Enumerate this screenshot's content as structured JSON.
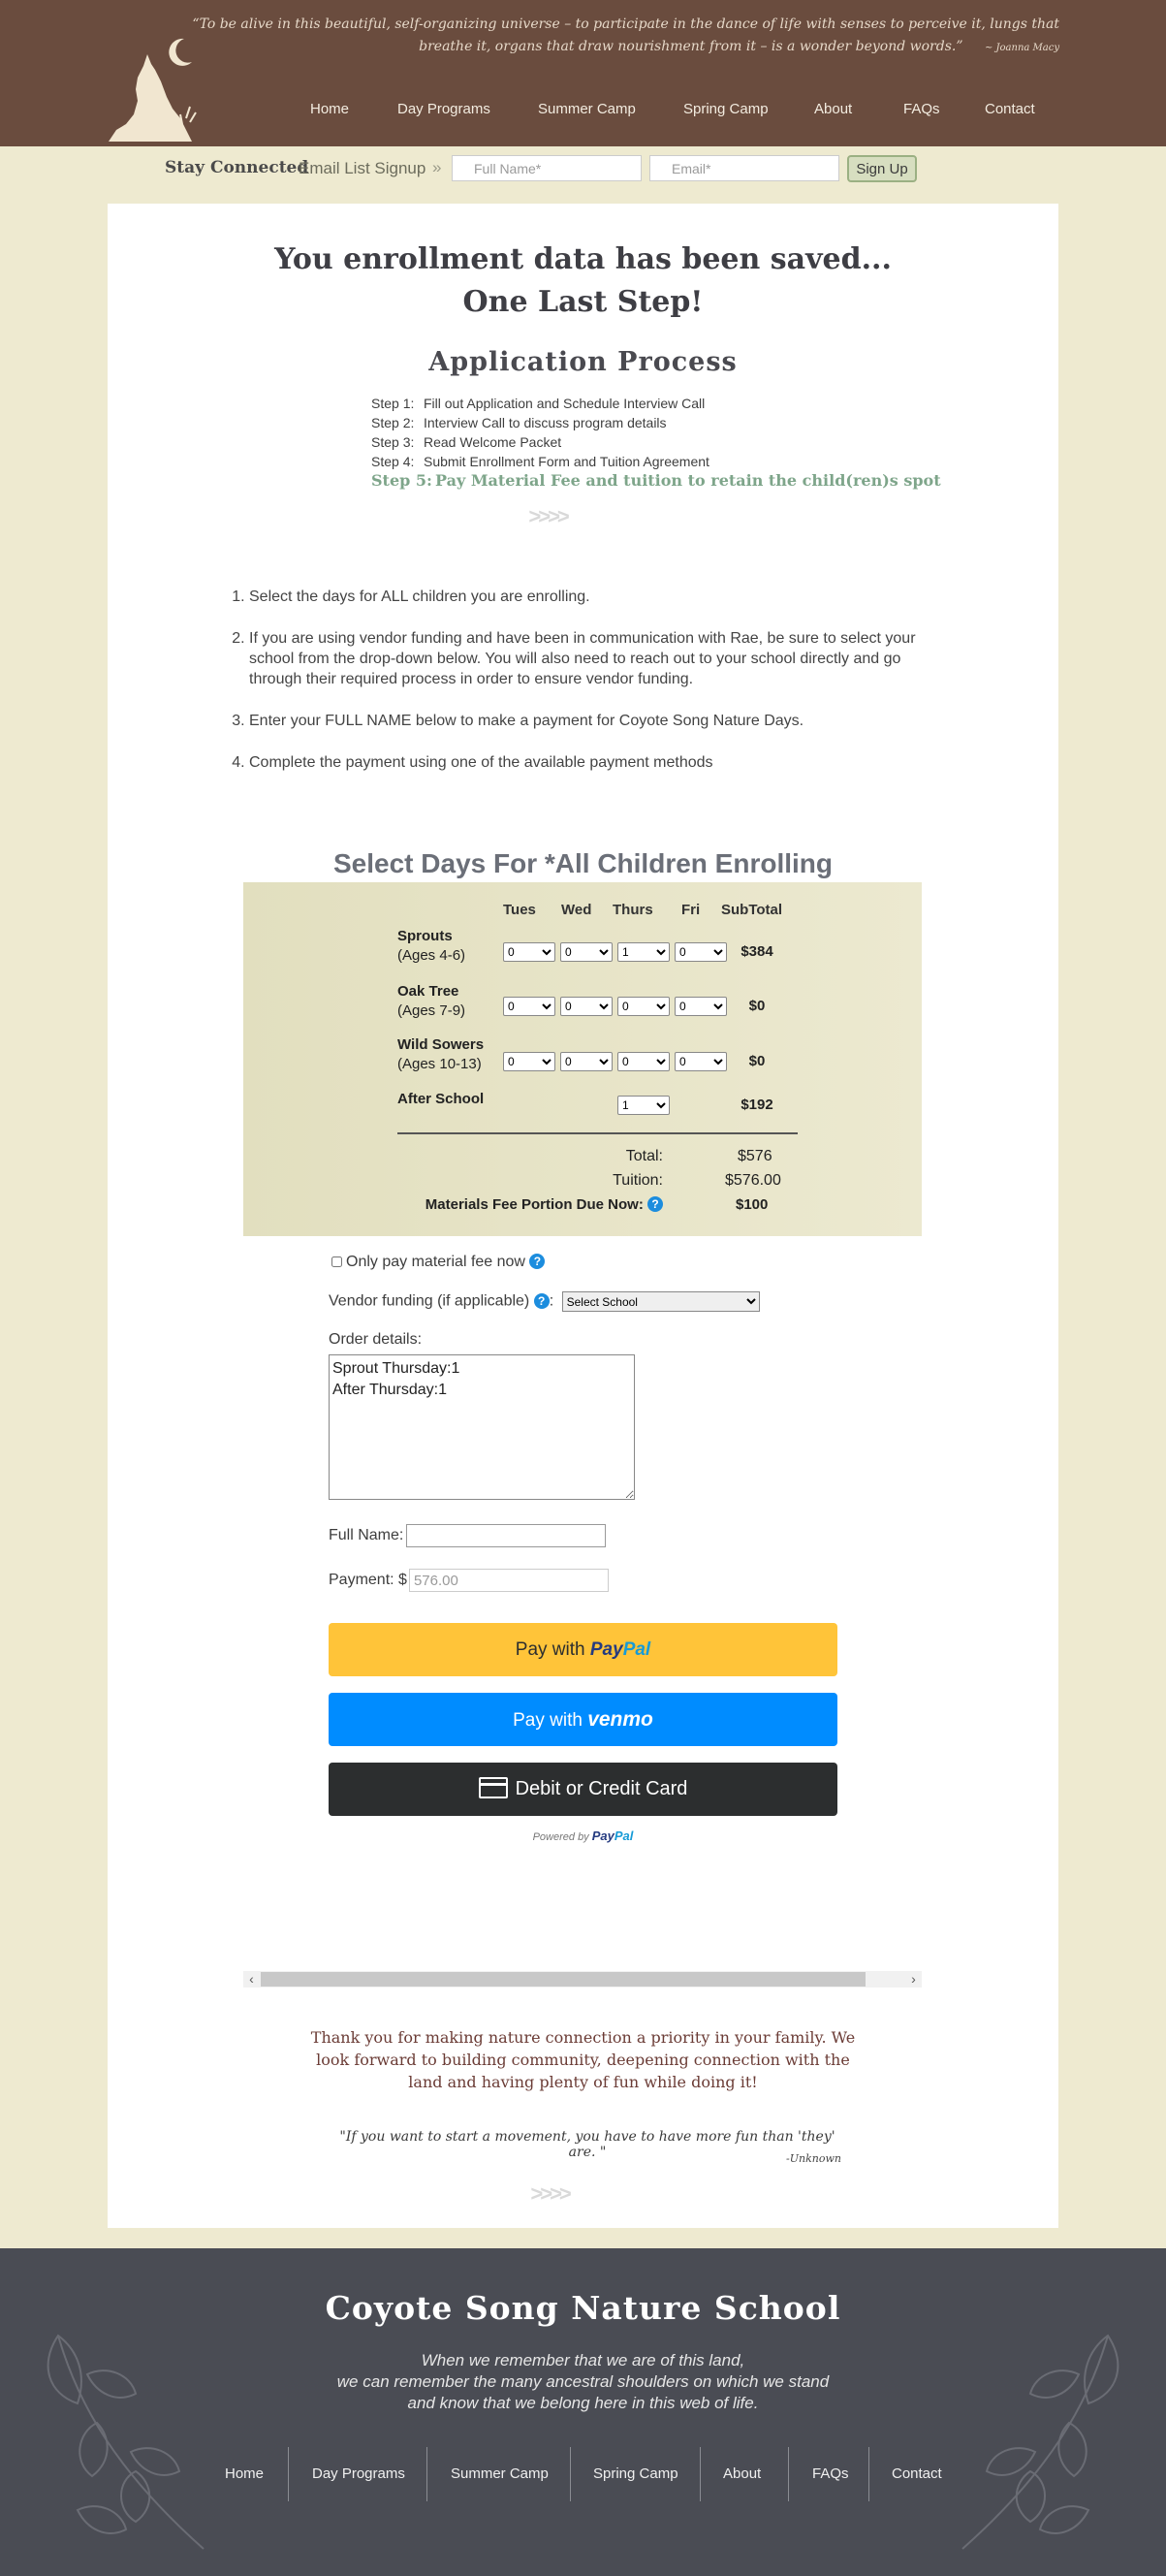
{
  "header": {
    "quote": "“To be alive in this beautiful, self-organizing universe – to participate in the dance of life with senses to perceive it, lungs that breathe it, organs that draw nourishment from it – is a wonder beyond words.”",
    "quote_author": "~ Joanna Macy",
    "nav": [
      "Home",
      "Day Programs",
      "Summer Camp",
      "Spring Camp",
      "About",
      "FAQs",
      "Contact"
    ]
  },
  "signup": {
    "stay_connected": "Stay Connected",
    "email_list": "Email List Signup",
    "chevron": "»",
    "name_placeholder": "Full Name*",
    "email_placeholder": "Email*",
    "button": "Sign Up"
  },
  "main": {
    "saved_line1": "You enrollment data has been saved...",
    "saved_line2": "One Last Step!",
    "process_title": "Application Process",
    "steps": [
      {
        "num": "Step 1:",
        "text": "Fill out Application and Schedule Interview Call"
      },
      {
        "num": "Step 2:",
        "text": "Interview Call to discuss program details"
      },
      {
        "num": "Step 3:",
        "text": "Read Welcome Packet"
      },
      {
        "num": "Step 4:",
        "text": "Submit Enrollment Form and Tuition Agreement"
      },
      {
        "num": "Step 5:",
        "text": "Pay Material Fee and tuition to retain the child(ren)s spot"
      }
    ],
    "instructions": [
      "Select the days for ALL children you are enrolling.",
      "If you are using vendor funding and have been in communication with Rae, be sure to select your school from the drop-down below. You will also need to reach out to your school directly and go through their required process in order to ensure vendor funding.",
      "Enter your FULL NAME below to make a payment for Coyote Song Nature Days.",
      "Complete the payment using one of the available payment methods"
    ]
  },
  "days": {
    "title": "Select Days For *All Children Enrolling",
    "columns": [
      "Tues",
      "Wed",
      "Thurs",
      "Fri",
      "SubTotal"
    ],
    "rows": [
      {
        "name": "Sprouts",
        "ages": "(Ages 4-6)",
        "tues": "0",
        "wed": "0",
        "thurs": "1",
        "fri": "0",
        "subtotal": "$384"
      },
      {
        "name": "Oak Tree",
        "ages": "(Ages 7-9)",
        "tues": "0",
        "wed": "0",
        "thurs": "0",
        "fri": "0",
        "subtotal": "$0"
      },
      {
        "name": "Wild Sowers",
        "ages": "(Ages 10-13)",
        "tues": "0",
        "wed": "0",
        "thurs": "0",
        "fri": "0",
        "subtotal": "$0"
      },
      {
        "name": "After School",
        "ages": "",
        "thurs": "1",
        "subtotal": "$192"
      }
    ],
    "total_label": "Total:",
    "total_value": "$576",
    "tuition_label": "Tuition:",
    "tuition_value": "$576.00",
    "materials_label": "Materials Fee Portion Due Now:",
    "materials_value": "$100"
  },
  "form": {
    "only_material": "Only pay material fee now",
    "vendor_label": "Vendor funding (if applicable)",
    "vendor_select": "Select School",
    "order_label": "Order details:",
    "order_details": "Sprout Thursday:1\nAfter Thursday:1",
    "full_name_label": "Full Name:",
    "payment_label": "Payment: $",
    "payment_value": "576.00"
  },
  "paypal": {
    "pay_with": "Pay with",
    "paypal_a": "Pay",
    "paypal_b": "Pal",
    "venmo": "venmo",
    "card": "Debit or Credit Card",
    "powered_by": "Powered by"
  },
  "closing": {
    "thanks": "Thank you for making nature connection a priority in your family. We look forward to building community, deepening connection with the land and having plenty of fun while doing it!",
    "quote": "\"If you want to start a movement, you have to have more fun than 'they' are. \"",
    "quote_author": "-Unknown"
  },
  "footer": {
    "title": "Coyote Song Nature School",
    "poem": [
      "When we remember that we are of this land,",
      "we can remember the many ancestral shoulders on which we stand",
      "and know that we belong here in this web of life."
    ],
    "nav": [
      "Home",
      "Day Programs",
      "Summer Camp",
      "Spring Camp",
      "About",
      "FAQs",
      "Contact"
    ]
  },
  "colors": {
    "header_bg": "#6a4c3e",
    "page_bg": "#eeead0",
    "footer_bg": "#4a4c54",
    "step_active": "#7ea58a",
    "paypal_yellow": "#ffc439",
    "venmo_blue": "#008cff"
  }
}
